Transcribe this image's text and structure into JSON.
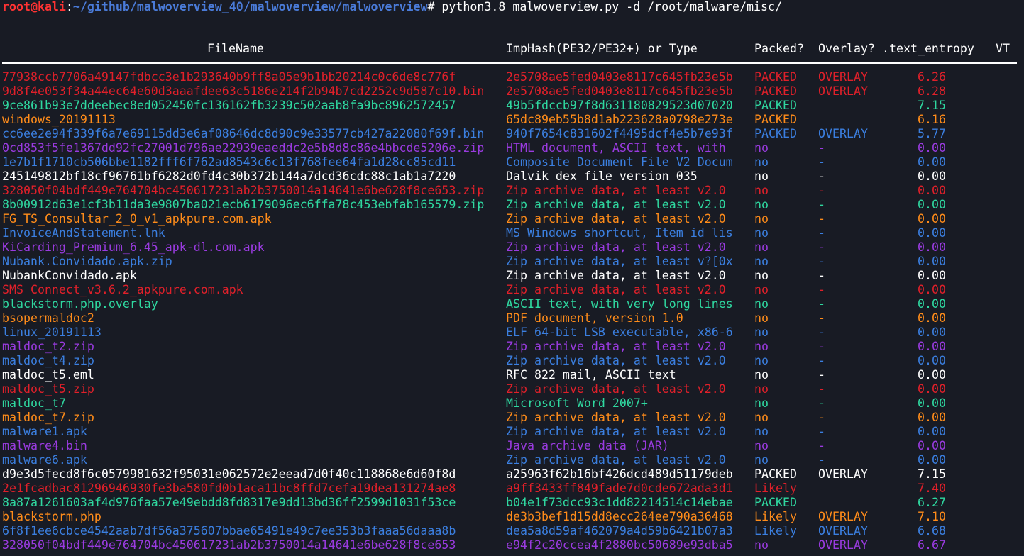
{
  "prompt": {
    "user_host": "root@kali",
    "separator": ":",
    "path": "~/github/malwoverview_40/malwoverview/malwoverview",
    "hash": "# ",
    "command": "python3.8 malwoverview.py -d /root/malware/misc/"
  },
  "table": {
    "headers": {
      "filename": "FileName",
      "imphash": "ImpHash(PE32/PE32+) or Type",
      "packed": "Packed?",
      "overlay": "Overlay?",
      "entropy": ".text_entropy",
      "vt": "VT"
    },
    "rows": [
      {
        "color": "red",
        "filename": "77938ccb7706a49147fdbcc3e1b293640b9ff8a05e9b1bb20214c0c6de8c776f",
        "imphash": "2e5708ae5fed0403e8117c645fb23e5b",
        "packed": "PACKED",
        "overlay": "OVERLAY",
        "entropy": "6.26"
      },
      {
        "color": "red",
        "filename": "9d8f4e053f34a44ec64e60d3aaafdee63c5186e214f2b94b7cd2252c9d587c10.bin",
        "imphash": "2e5708ae5fed0403e8117c645fb23e5b",
        "packed": "PACKED",
        "overlay": "OVERLAY",
        "entropy": "6.28"
      },
      {
        "color": "green",
        "filename": "9ce861b93e7ddeebec8ed052450fc136162fb3239c502aab8fa9bc8962572457",
        "imphash": "49b5fdccb97f8d631180829523d07020",
        "packed": "PACKED",
        "overlay": "",
        "entropy": "7.15"
      },
      {
        "color": "orange",
        "filename": "windows_20191113",
        "imphash": "65dc89eb55b8d1ab223628a0798e273e",
        "packed": "PACKED",
        "overlay": "",
        "entropy": "6.16"
      },
      {
        "color": "blue",
        "filename": "cc6ee2e94f339f6a7e69115dd3e6af08646dc8d90c9e33577cb427a22080f69f.bin",
        "imphash": "940f7654c831602f4495dcf4e5b7e93f",
        "packed": "PACKED",
        "overlay": "OVERLAY",
        "entropy": "5.77"
      },
      {
        "color": "purple",
        "filename": "0cd853f5fe1367dd92fc27001d796ae22939eaeddc2e5b8d8c86e4bbcde5206e.zip",
        "imphash": "HTML document, ASCII text, with",
        "packed": "no",
        "overlay": "-",
        "entropy": "0.00"
      },
      {
        "color": "blue",
        "filename": "1e7b1f1710cb506bbe1182fff6f762ad8543c6c13f768fee64fa1d28cc85cd11",
        "imphash": "Composite Document File V2 Docum",
        "packed": "no",
        "overlay": "-",
        "entropy": "0.00"
      },
      {
        "color": "white",
        "filename": "245149812bf18cf96761bf6282d0fd4c30b372b144a7dcd36cdc88c1ab1a7220",
        "imphash": "Dalvik dex file version 035",
        "packed": "no",
        "overlay": "-",
        "entropy": "0.00"
      },
      {
        "color": "red",
        "filename": "328050f04bdf449e764704bc450617231ab2b3750014a14641e6be628f8ce653.zip",
        "imphash": "Zip archive data, at least v2.0",
        "packed": "no",
        "overlay": "-",
        "entropy": "0.00"
      },
      {
        "color": "green",
        "filename": "8b00912d63e1cf3b11da3e9807ba021ecb6179096ec6ffa78c453ebfab165579.zip",
        "imphash": "Zip archive data, at least v2.0",
        "packed": "no",
        "overlay": "-",
        "entropy": "0.00"
      },
      {
        "color": "orange",
        "filename": "FG_TS_Consultar_2_0_v1_apkpure.com.apk",
        "imphash": "Zip archive data, at least v2.0",
        "packed": "no",
        "overlay": "-",
        "entropy": "0.00"
      },
      {
        "color": "blue",
        "filename": "InvoiceAndStatement.lnk",
        "imphash": "MS Windows shortcut, Item id lis",
        "packed": "no",
        "overlay": "-",
        "entropy": "0.00"
      },
      {
        "color": "purple",
        "filename": "KiCarding_Premium_6.45_apk-dl.com.apk",
        "imphash": "Zip archive data, at least v2.0",
        "packed": "no",
        "overlay": "-",
        "entropy": "0.00"
      },
      {
        "color": "blue",
        "filename": "Nubank.Convidado.apk.zip",
        "imphash": "Zip archive data, at least v?[0x",
        "packed": "no",
        "overlay": "-",
        "entropy": "0.00"
      },
      {
        "color": "white",
        "filename": "NubankConvidado.apk",
        "imphash": "Zip archive data, at least v2.0",
        "packed": "no",
        "overlay": "-",
        "entropy": "0.00"
      },
      {
        "color": "red",
        "filename": "SMS Connect_v3.6.2_apkpure.com.apk",
        "imphash": "Zip archive data, at least v2.0",
        "packed": "no",
        "overlay": "-",
        "entropy": "0.00"
      },
      {
        "color": "green",
        "filename": "blackstorm.php.overlay",
        "imphash": "ASCII text, with very long lines",
        "packed": "no",
        "overlay": "-",
        "entropy": "0.00"
      },
      {
        "color": "orange",
        "filename": "bsopermaldoc2",
        "imphash": "PDF document, version 1.0",
        "packed": "no",
        "overlay": "-",
        "entropy": "0.00"
      },
      {
        "color": "blue",
        "filename": "linux_20191113",
        "imphash": "ELF 64-bit LSB executable, x86-6",
        "packed": "no",
        "overlay": "-",
        "entropy": "0.00"
      },
      {
        "color": "purple",
        "filename": "maldoc_t2.zip",
        "imphash": "Zip archive data, at least v2.0",
        "packed": "no",
        "overlay": "-",
        "entropy": "0.00"
      },
      {
        "color": "blue",
        "filename": "maldoc_t4.zip",
        "imphash": "Zip archive data, at least v2.0",
        "packed": "no",
        "overlay": "-",
        "entropy": "0.00"
      },
      {
        "color": "white",
        "filename": "maldoc_t5.eml",
        "imphash": "RFC 822 mail, ASCII text",
        "packed": "no",
        "overlay": "-",
        "entropy": "0.00"
      },
      {
        "color": "red",
        "filename": "maldoc_t5.zip",
        "imphash": "Zip archive data, at least v2.0",
        "packed": "no",
        "overlay": "-",
        "entropy": "0.00"
      },
      {
        "color": "green",
        "filename": "maldoc_t7",
        "imphash": "Microsoft Word 2007+",
        "packed": "no",
        "overlay": "-",
        "entropy": "0.00"
      },
      {
        "color": "orange",
        "filename": "maldoc_t7.zip",
        "imphash": "Zip archive data, at least v2.0",
        "packed": "no",
        "overlay": "-",
        "entropy": "0.00"
      },
      {
        "color": "blue",
        "filename": "malware1.apk",
        "imphash": "Zip archive data, at least v2.0",
        "packed": "no",
        "overlay": "-",
        "entropy": "0.00"
      },
      {
        "color": "purple",
        "filename": "malware4.bin",
        "imphash": "Java archive data (JAR)",
        "packed": "no",
        "overlay": "-",
        "entropy": "0.00"
      },
      {
        "color": "blue",
        "filename": "malware6.apk",
        "imphash": "Zip archive data, at least v2.0",
        "packed": "no",
        "overlay": "-",
        "entropy": "0.00"
      },
      {
        "color": "white",
        "filename": "d9e3d5fecd8f6c0579981632f95031e062572e2eead7d0f40c118868e6d60f8d",
        "imphash": "a25963f62b16bf426dcd489d51179deb",
        "packed": "PACKED",
        "overlay": "OVERLAY",
        "entropy": "7.15"
      },
      {
        "color": "red",
        "filename": "2e1fcadbac81296946930fe3ba580fd0b1aca11bc8ffd7cefa19dea131274ae8",
        "imphash": "a9ff3433ff849fade7d0cde672ada3d1",
        "packed": "Likely",
        "overlay": "",
        "entropy": "7.40"
      },
      {
        "color": "green",
        "filename": "8a87a1261603af4d976faa57e49ebdd8fd8317e9dd13bd36ff2599d1031f53ce",
        "imphash": "b04e1f73dcc93c1dd82214514c14ebae",
        "packed": "PACKED",
        "overlay": "",
        "entropy": "6.27"
      },
      {
        "color": "orange",
        "filename": "blackstorm.php",
        "imphash": "de3b3bef1d15dd8ecc264ee790a36468",
        "packed": "Likely",
        "overlay": "OVERLAY",
        "entropy": "7.10"
      },
      {
        "color": "blue",
        "filename": "6f8f1ee6cbce4542aab7df56a375607bbae65491e49c7ee353b3faaa56daaa8b",
        "imphash": "dea5a8d59af462079a4d59b6421b07a3",
        "packed": "Likely",
        "overlay": "OVERLAY",
        "entropy": "6.68"
      },
      {
        "color": "purple",
        "filename": "328050f04bdf449e764704bc450617231ab2b3750014a14641e6be628f8ce653",
        "imphash": "e94f2c20ccea4f2880bc50689e93dba5",
        "packed": "no",
        "overlay": "OVERLAY",
        "entropy": "6.67"
      }
    ]
  }
}
